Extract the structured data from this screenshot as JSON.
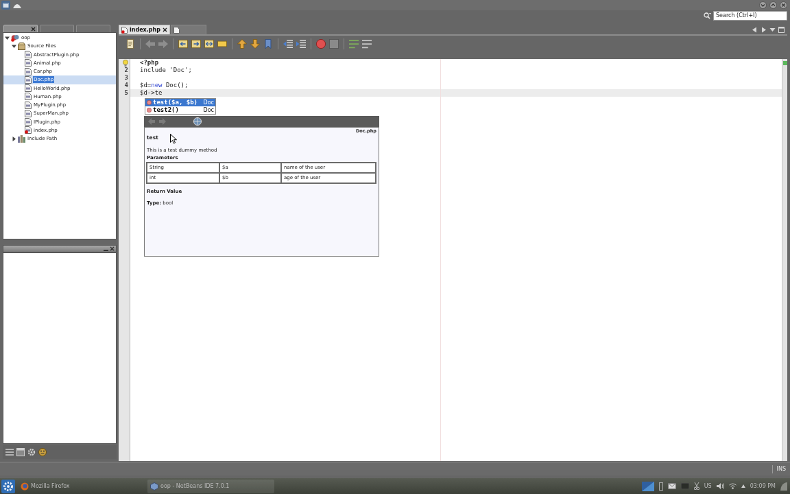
{
  "search": {
    "placeholder": "Search (Ctrl+I)"
  },
  "project_panel": {
    "tabs": [
      {
        "selected": true
      },
      {
        "selected": false
      },
      {
        "selected": false
      }
    ],
    "tree": [
      {
        "label": "oop",
        "kind": "project",
        "error": true,
        "expanded": true,
        "selected": false,
        "children": [
          {
            "label": "Source Files",
            "kind": "folder",
            "error": false,
            "expanded": true,
            "selected": false,
            "children": [
              {
                "label": "AbstractPlugin.php",
                "kind": "file",
                "error": false,
                "selected": false
              },
              {
                "label": "Animal.php",
                "kind": "file",
                "error": false,
                "selected": false
              },
              {
                "label": "Car.php",
                "kind": "file",
                "error": false,
                "selected": false
              },
              {
                "label": "Doc.php",
                "kind": "file",
                "error": false,
                "selected": true
              },
              {
                "label": "HelloWorld.php",
                "kind": "file",
                "error": false,
                "selected": false
              },
              {
                "label": "Human.php",
                "kind": "file",
                "error": false,
                "selected": false
              },
              {
                "label": "MyPlugin.php",
                "kind": "file",
                "error": false,
                "selected": false
              },
              {
                "label": "SuperMan.php",
                "kind": "file",
                "error": false,
                "selected": false
              },
              {
                "label": "IPlugin.php",
                "kind": "file",
                "error": false,
                "selected": false
              },
              {
                "label": "index.php",
                "kind": "file",
                "error": true,
                "selected": false
              }
            ]
          },
          {
            "label": "Include Path",
            "kind": "library",
            "error": false,
            "expanded": false,
            "selected": false
          }
        ]
      }
    ]
  },
  "editor": {
    "tabs": [
      {
        "label": "index.php",
        "error": true,
        "selected": true
      },
      {
        "error": false,
        "selected": false
      }
    ],
    "lines": [
      {
        "hint": true,
        "current": false,
        "tokens": [
          {
            "kind": "tag",
            "text": "<?php"
          }
        ]
      },
      {
        "number": "2",
        "hint": false,
        "current": false,
        "tokens": [
          {
            "kind": "plain",
            "text": "include 'Doc';"
          }
        ]
      },
      {
        "number": "3",
        "hint": false,
        "current": false
      },
      {
        "number": "4",
        "hint": false,
        "current": false,
        "tokens": [
          {
            "kind": "plain",
            "text": "$d="
          },
          {
            "kind": "keyword",
            "text": "new"
          },
          {
            "kind": "plain",
            "text": " Doc();"
          }
        ]
      },
      {
        "number": "5",
        "hint": false,
        "current": true,
        "tokens": [
          {
            "kind": "plain",
            "text": "$d->te"
          }
        ]
      }
    ],
    "completion": [
      {
        "name": "test($a, $b)",
        "owner": "Doc",
        "selected": true
      },
      {
        "name": "test2()",
        "owner": "Doc",
        "selected": false
      }
    ],
    "documentation": {
      "file": "Doc.php",
      "title": "test",
      "description": "This is a test dummy method",
      "parameters_heading": "Parameters",
      "parameters": [
        {
          "type": "String",
          "name": "$a",
          "description": "name of the user"
        },
        {
          "type": "int",
          "name": "$b",
          "description": "age of the user"
        }
      ],
      "return_heading": "Return Value",
      "return_type": "**Type:** bool"
    }
  },
  "status_bar": {
    "insert_mode": "INS"
  },
  "taskbar": {
    "tasks": [
      {
        "label": "Mozilla Firefox",
        "selected": false
      },
      {
        "label": "oop - NetBeans IDE 7.0.1",
        "selected": true
      }
    ],
    "keyboard_layout": "US",
    "clock": "03:09 PM"
  }
}
